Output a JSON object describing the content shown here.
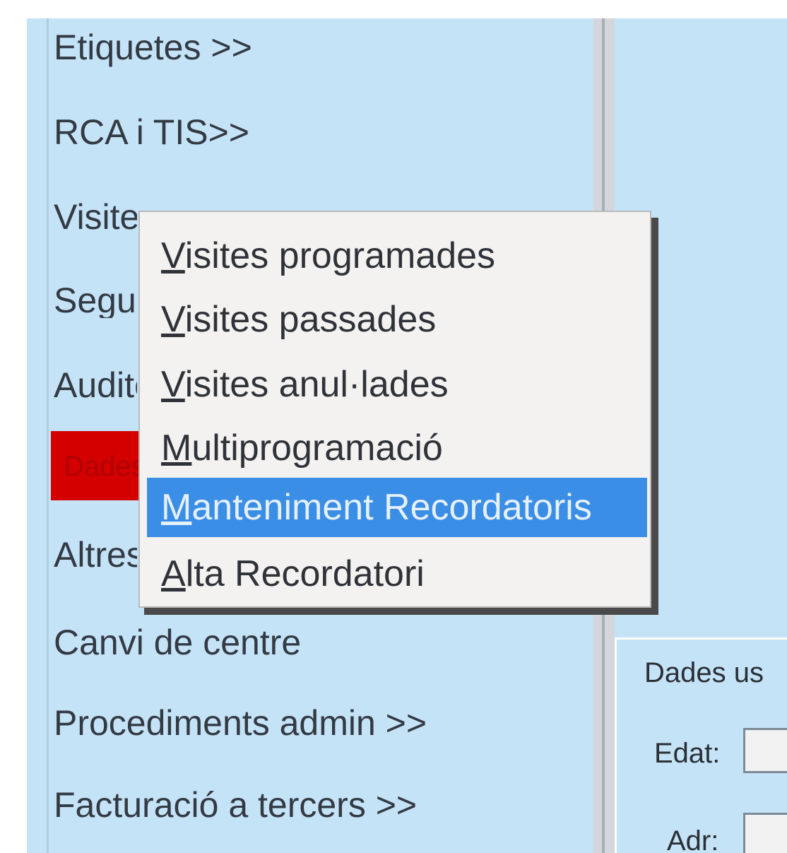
{
  "nav": {
    "items": [
      {
        "label": "Etiquetes >>"
      },
      {
        "label": "RCA i TIS>>"
      },
      {
        "label": "Visites >>"
      },
      {
        "label": "Seguiment >>"
      },
      {
        "label": "Auditoria >>"
      },
      {
        "label": "Dades"
      },
      {
        "label": "Altres >>"
      },
      {
        "label": "Canvi de centre"
      },
      {
        "label": "Procediments admin >>"
      },
      {
        "label": "Facturació a tercers >>"
      }
    ]
  },
  "popup_menu": {
    "items": [
      {
        "mnemonic": "V",
        "rest": "isites programades"
      },
      {
        "mnemonic": "V",
        "rest": "isites passades"
      },
      {
        "mnemonic": "V",
        "rest": "isites anul·lades"
      },
      {
        "mnemonic": "M",
        "rest": "ultiprogramació"
      },
      {
        "mnemonic": "M",
        "rest": "anteniment Recordatoris",
        "selected": true
      },
      {
        "mnemonic": "A",
        "rest": "lta Recordatori"
      }
    ]
  },
  "form": {
    "legend": "Dades us",
    "edat_label": "Edat:",
    "adr_label": "Adr:"
  },
  "colors": {
    "panel": "#c5e3f7",
    "selection": "#3a8ee6",
    "alert": "#d40000"
  }
}
